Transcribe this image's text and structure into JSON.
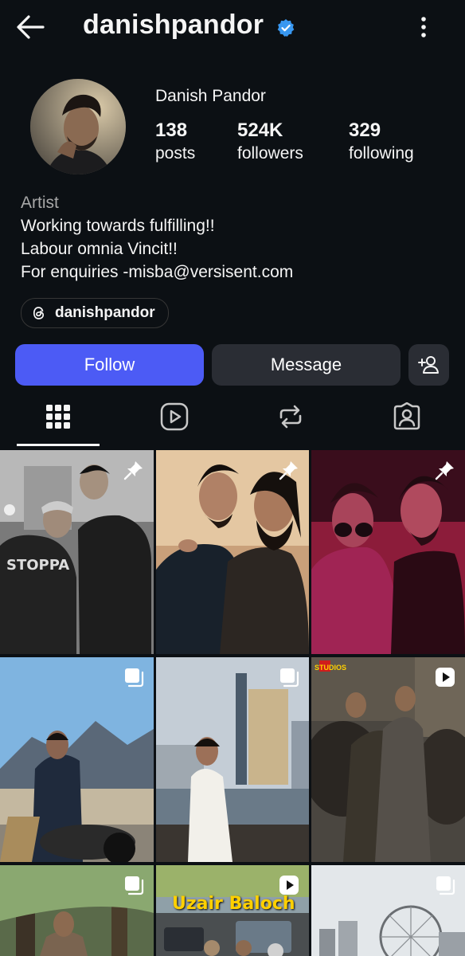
{
  "header": {
    "username": "danishpandor",
    "back_icon": "back-arrow-icon",
    "verified_icon": "verified-badge-icon",
    "more_icon": "more-vertical-icon"
  },
  "profile": {
    "display_name": "Danish Pandor",
    "stats": [
      {
        "value": "138",
        "label": "posts"
      },
      {
        "value": "524K",
        "label": "followers"
      },
      {
        "value": "329",
        "label": "following"
      }
    ],
    "category": "Artist",
    "bio_lines": [
      "Working towards fulfilling!!",
      "Labour omnia Vincit!!",
      "For enquiries -misba@versisent.com"
    ],
    "threads_handle": "danishpandor"
  },
  "actions": {
    "follow_label": "Follow",
    "message_label": "Message",
    "add_user_icon": "add-user-icon"
  },
  "tabs": [
    "grid-icon",
    "reels-icon",
    "reposts-icon",
    "tagged-icon"
  ],
  "grid": {
    "posts": [
      {
        "badge": "pin-icon"
      },
      {
        "badge": "pin-icon"
      },
      {
        "badge": "pin-icon"
      },
      {
        "badge": "carousel-icon"
      },
      {
        "badge": "carousel-icon"
      },
      {
        "badge": "reel-icon",
        "overlay": "STUDIOS"
      },
      {
        "badge": "carousel-icon"
      },
      {
        "badge": "reel-icon",
        "caption": "Uzair Baloch"
      },
      {
        "badge": "carousel-icon"
      }
    ]
  },
  "colors": {
    "background": "#0c1014",
    "follow_button": "#4c5bf5",
    "secondary_button": "#2a2d34",
    "verified": "#3897f0"
  }
}
